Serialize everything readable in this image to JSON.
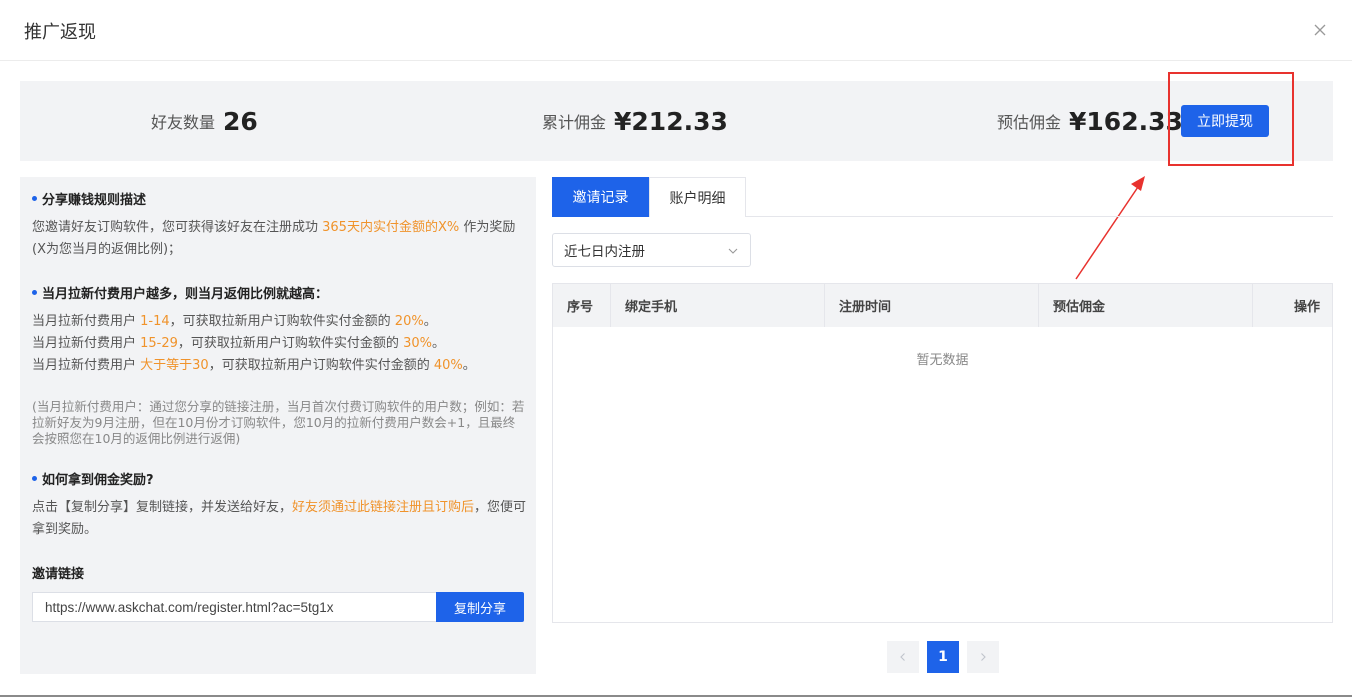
{
  "header": {
    "title": "推广返现"
  },
  "stats": {
    "friends_label": "好友数量",
    "friends_value": "26",
    "total_label": "累计佣金",
    "total_value": "¥212.33",
    "estimated_label": "预估佣金",
    "estimated_value": "¥162.33",
    "withdraw_label": "立即提现"
  },
  "rules": {
    "section1_title": "分享赚钱规则描述",
    "section1_text_a": "您邀请好友订购软件，您可获得该好友在注册成功 ",
    "section1_text_hl": "365天内实付金额的X%",
    "section1_text_b": " 作为奖励(X为您当月的返佣比例)；",
    "section2_title": "当月拉新付费用户越多，则当月返佣比例就越高：",
    "tiers": [
      {
        "pre": "当月拉新付费用户 ",
        "range": "1-14",
        "mid": "，可获取拉新用户订购软件实付金额的 ",
        "pct": "20%",
        "post": "。"
      },
      {
        "pre": "当月拉新付费用户 ",
        "range": "15-29",
        "mid": "，可获取拉新用户订购软件实付金额的 ",
        "pct": "30%",
        "post": "。"
      },
      {
        "pre": "当月拉新付费用户 ",
        "range": "大于等于30",
        "mid": "，可获取拉新用户订购软件实付金额的 ",
        "pct": "40%",
        "post": "。"
      }
    ],
    "note": "(当月拉新付费用户：通过您分享的链接注册，当月首次付费订购软件的用户数；例如：若拉新好友为9月注册，但在10月份才订购软件，您10月的拉新付费用户数会+1，且最终会按照您在10月的返佣比例进行返佣)",
    "section3_title": "如何拿到佣金奖励?",
    "section3_text_a": "点击【复制分享】复制链接，并发送给好友，",
    "section3_text_hl": "好友须通过此链接注册且订购后",
    "section3_text_b": "，您便可拿到奖励。",
    "link_label": "邀请链接",
    "link_value": "https://www.askchat.com/register.html?ac=5tg1x",
    "copy_label": "复制分享"
  },
  "records": {
    "tabs": [
      "邀请记录",
      "账户明细"
    ],
    "filter_value": "近七日内注册",
    "columns": [
      "序号",
      "绑定手机",
      "注册时间",
      "预估佣金",
      "操作"
    ],
    "empty_text": "暂无数据",
    "current_page": "1"
  },
  "colors": {
    "primary": "#1e63e9",
    "highlight": "#f0932b",
    "annotation": "#e8322e"
  }
}
